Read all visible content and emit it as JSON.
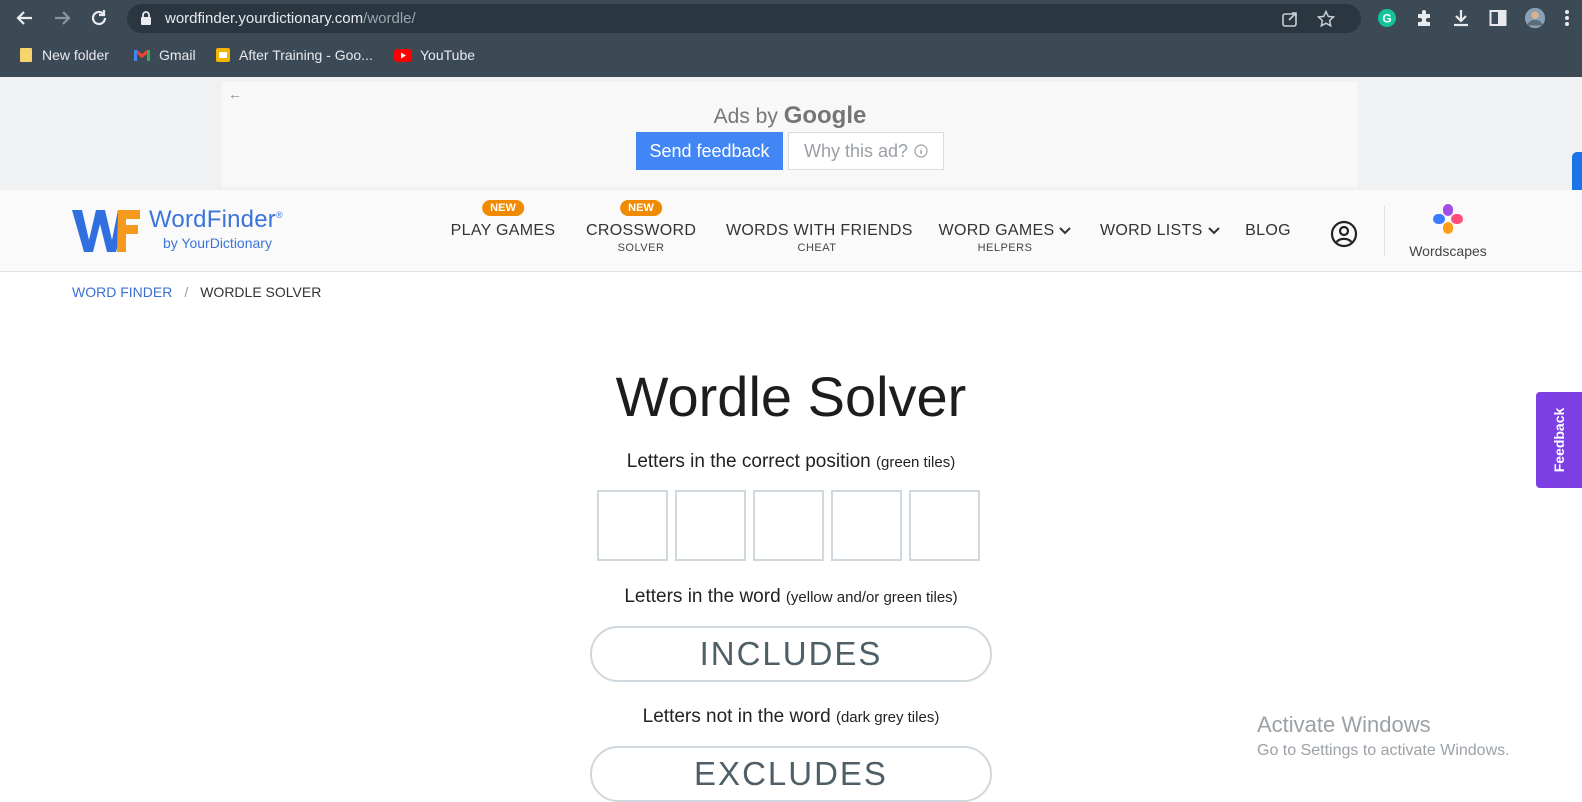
{
  "browser": {
    "url_host": "wordfinder.yourdictionary.com",
    "url_path": "/wordle/",
    "bookmarks": [
      {
        "label": "New folder",
        "icon": "folder-icon"
      },
      {
        "label": "Gmail",
        "icon": "gmail-icon"
      },
      {
        "label": "After Training - Goo...",
        "icon": "slides-icon"
      },
      {
        "label": "YouTube",
        "icon": "youtube-icon"
      }
    ]
  },
  "ad": {
    "ads_by": "Ads by",
    "google": "Google",
    "send_feedback": "Send feedback",
    "why_this_ad": "Why this ad?"
  },
  "header": {
    "logo_title": "WordFinder",
    "logo_reg": "®",
    "logo_sub": "by YourDictionary",
    "menu": [
      {
        "label": "PLAY GAMES",
        "sub": "",
        "badge": "NEW"
      },
      {
        "label": "CROSSWORD",
        "sub": "SOLVER",
        "badge": "NEW"
      },
      {
        "label": "WORDS WITH FRIENDS",
        "sub": "CHEAT",
        "badge": ""
      },
      {
        "label": "WORD GAMES",
        "sub": "HELPERS",
        "badge": ""
      },
      {
        "label": "WORD LISTS",
        "sub": "",
        "badge": ""
      },
      {
        "label": "BLOG",
        "sub": "",
        "badge": ""
      }
    ],
    "wordscapes": "Wordscapes"
  },
  "breadcrumb": {
    "home": "WORD FINDER",
    "separator": "/",
    "current": "WORDLE SOLVER"
  },
  "solver": {
    "title": "Wordle Solver",
    "correct_label": "Letters in the correct position",
    "correct_hint": "(green tiles)",
    "tiles": [
      "",
      "",
      "",
      "",
      ""
    ],
    "includes_label": "Letters in the word",
    "includes_hint": "(yellow and/or green tiles)",
    "includes_button": "INCLUDES",
    "excludes_label": "Letters not in the word",
    "excludes_hint": "(dark grey tiles)",
    "excludes_button": "EXCLUDES"
  },
  "feedback_tab": "Feedback",
  "watermark": {
    "line1": "Activate Windows",
    "line2": "Go to Settings to activate Windows."
  },
  "colors": {
    "brand_blue": "#3b74d9",
    "badge_orange": "#f08a00",
    "feedback_purple": "#7b3fe4",
    "google_blue": "#4285f4",
    "chrome_bg": "#3c4a55"
  }
}
